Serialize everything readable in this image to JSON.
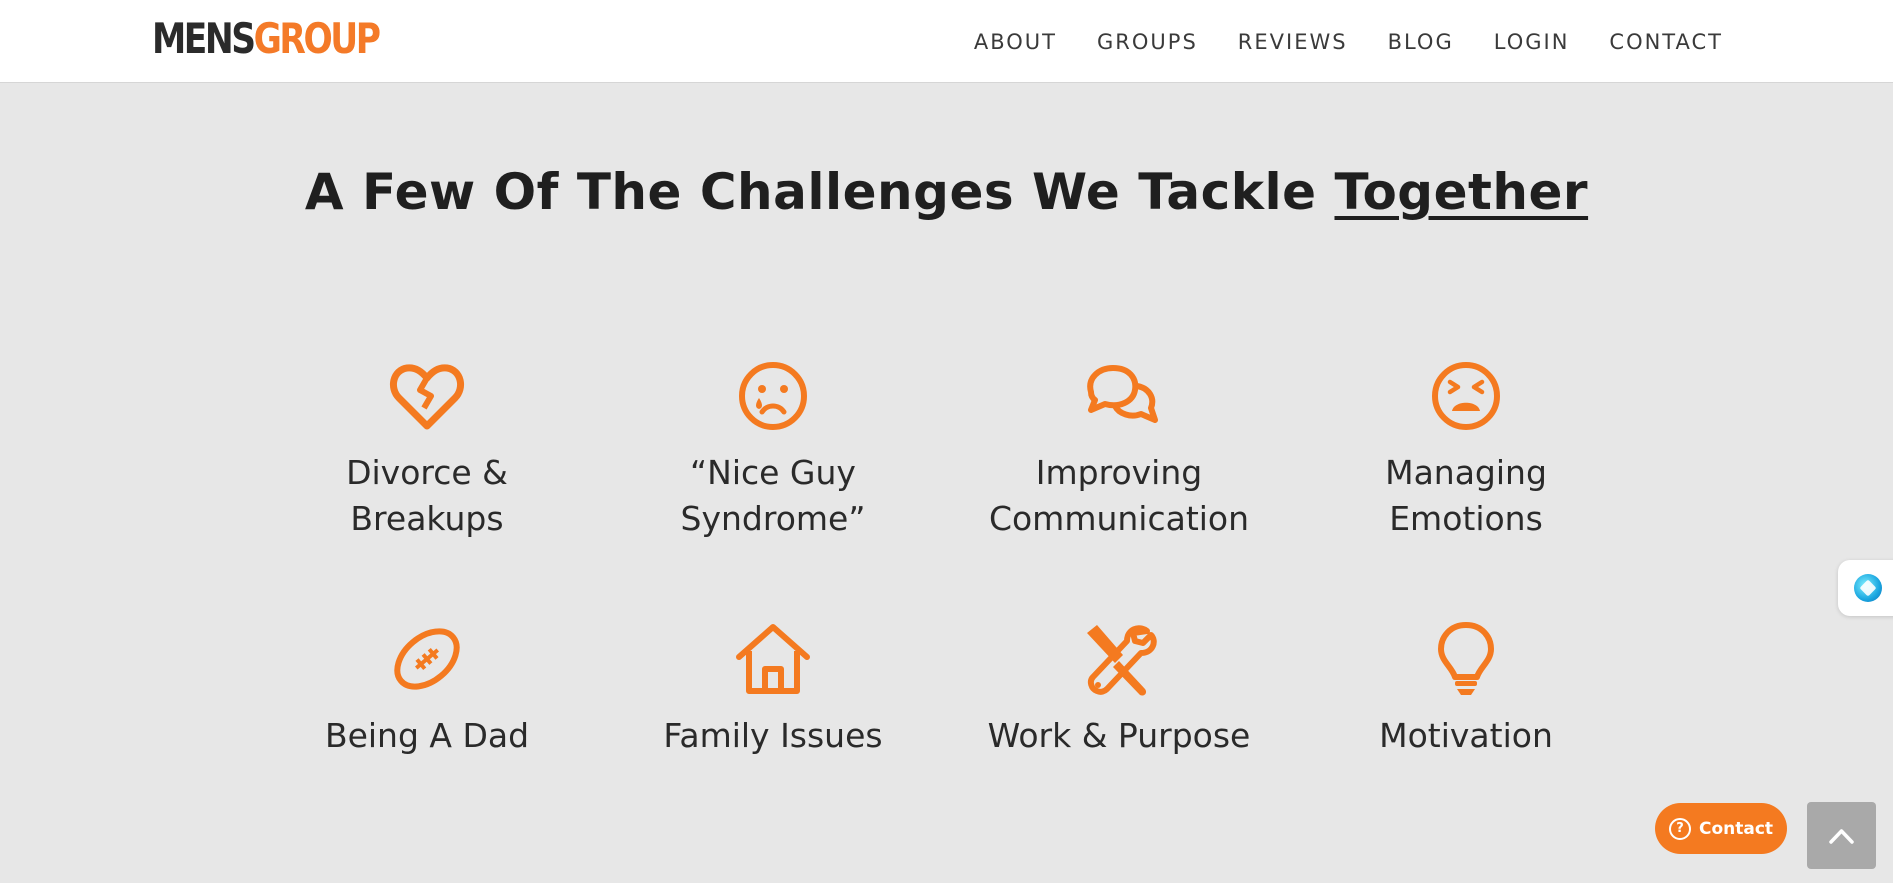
{
  "brand": {
    "part1": "MENS",
    "part2": "GROUP",
    "accent": "#f47a28",
    "dark": "#2b2b2b"
  },
  "nav": {
    "items": [
      {
        "label": "ABOUT"
      },
      {
        "label": "GROUPS"
      },
      {
        "label": "REVIEWS"
      },
      {
        "label": "BLOG"
      },
      {
        "label": "LOGIN"
      },
      {
        "label": "CONTACT"
      }
    ]
  },
  "section": {
    "heading_main": "A Few Of The Challenges We Tackle",
    "heading_emphasis": "Together"
  },
  "challenges": [
    {
      "icon": "broken-heart-icon",
      "line1": "Divorce &",
      "line2": "Breakups"
    },
    {
      "icon": "crying-face-icon",
      "line1": "“Nice Guy",
      "line2": "Syndrome”"
    },
    {
      "icon": "chat-bubbles-icon",
      "line1": "Improving",
      "line2": "Communication"
    },
    {
      "icon": "angry-face-icon",
      "line1": "Managing",
      "line2": "Emotions"
    },
    {
      "icon": "football-icon",
      "line1": "Being A Dad",
      "line2": ""
    },
    {
      "icon": "house-icon",
      "line1": "Family Issues",
      "line2": ""
    },
    {
      "icon": "tools-icon",
      "line1": "Work & Purpose",
      "line2": ""
    },
    {
      "icon": "lightbulb-icon",
      "line1": "Motivation",
      "line2": ""
    }
  ],
  "floating": {
    "contact_label": "Contact",
    "help_glyph": "?"
  },
  "colors": {
    "icon": "#f47a20",
    "background": "#e7e7e7",
    "scroll_top": "#a9a9a9"
  }
}
